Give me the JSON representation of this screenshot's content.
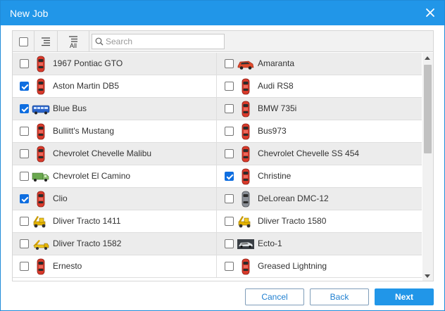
{
  "dialog": {
    "title": "New Job",
    "close_icon": "close-icon"
  },
  "toolbar": {
    "select_all_checked": false,
    "list_icon": "list-icon",
    "all_icon_label": "All",
    "search_placeholder": "Search",
    "search_value": ""
  },
  "rows": [
    [
      {
        "name": "1967 Pontiac GTO",
        "checked": false,
        "icon": "red-car-icon"
      },
      {
        "name": "Amaranta",
        "checked": false,
        "icon": "red-sedan-side-icon"
      }
    ],
    [
      {
        "name": "Aston Martin DB5",
        "checked": true,
        "icon": "red-car-icon"
      },
      {
        "name": "Audi RS8",
        "checked": false,
        "icon": "red-car-icon"
      }
    ],
    [
      {
        "name": "Blue Bus",
        "checked": true,
        "icon": "blue-bus-icon"
      },
      {
        "name": "BMW 735i",
        "checked": false,
        "icon": "red-car-icon"
      }
    ],
    [
      {
        "name": "Bullitt's Mustang",
        "checked": false,
        "icon": "red-car-icon"
      },
      {
        "name": "Bus973",
        "checked": false,
        "icon": "red-car-icon"
      }
    ],
    [
      {
        "name": "Chevrolet Chevelle Malibu",
        "checked": false,
        "icon": "red-car-icon"
      },
      {
        "name": "Chevrolet Chevelle SS 454",
        "checked": false,
        "icon": "red-car-icon"
      }
    ],
    [
      {
        "name": "Chevrolet El Camino",
        "checked": false,
        "icon": "green-truck-icon"
      },
      {
        "name": "Christine",
        "checked": true,
        "icon": "red-car-icon"
      }
    ],
    [
      {
        "name": "Clio",
        "checked": true,
        "icon": "red-car-icon"
      },
      {
        "name": "DeLorean DMC-12",
        "checked": false,
        "icon": "gray-car-icon"
      }
    ],
    [
      {
        "name": "Dliver Tracto 1411",
        "checked": false,
        "icon": "yellow-tractor-icon"
      },
      {
        "name": "Dliver Tracto 1580",
        "checked": false,
        "icon": "yellow-tractor-icon"
      }
    ],
    [
      {
        "name": "Dliver Tracto 1582",
        "checked": false,
        "icon": "yellow-truck-icon"
      },
      {
        "name": "Ecto-1",
        "checked": false,
        "icon": "dark-car-photo-icon"
      }
    ],
    [
      {
        "name": "Ernesto",
        "checked": false,
        "icon": "red-car-icon"
      },
      {
        "name": "Greased Lightning",
        "checked": false,
        "icon": "red-car-icon"
      }
    ]
  ],
  "footer": {
    "cancel_label": "Cancel",
    "back_label": "Back",
    "next_label": "Next"
  },
  "colors": {
    "accent": "#2196e8",
    "checkbox_checked": "#0f6ee0",
    "row_shade": "#ececec",
    "car_red": "#d93a2b"
  }
}
